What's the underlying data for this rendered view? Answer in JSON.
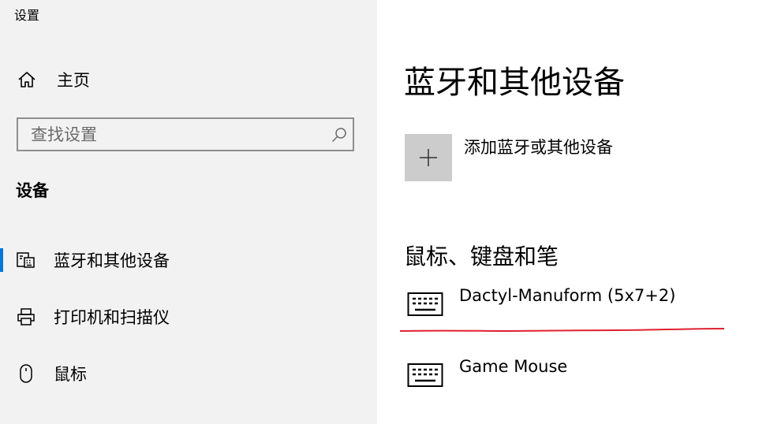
{
  "window": {
    "title": "设置"
  },
  "sidebar": {
    "home_label": "主页",
    "search": {
      "placeholder": "查找设置",
      "value": ""
    },
    "section_title": "设备",
    "items": [
      {
        "label": "蓝牙和其他设备",
        "icon": "bluetooth-devices-icon",
        "selected": true
      },
      {
        "label": "打印机和扫描仪",
        "icon": "printer-icon",
        "selected": false
      },
      {
        "label": "鼠标",
        "icon": "mouse-icon",
        "selected": false
      }
    ]
  },
  "main": {
    "title": "蓝牙和其他设备",
    "add_device_label": "添加蓝牙或其他设备",
    "section_title": "鼠标、键盘和笔",
    "devices": [
      {
        "name": "Dactyl-Manuform (5x7+2)",
        "icon": "keyboard-icon"
      },
      {
        "name": "Game Mouse",
        "icon": "keyboard-icon"
      }
    ]
  },
  "colors": {
    "accent": "#0078d7",
    "sidebar_bg": "#f2f2f2",
    "annotation_red": "#e02030",
    "add_tile": "#cccccc"
  }
}
